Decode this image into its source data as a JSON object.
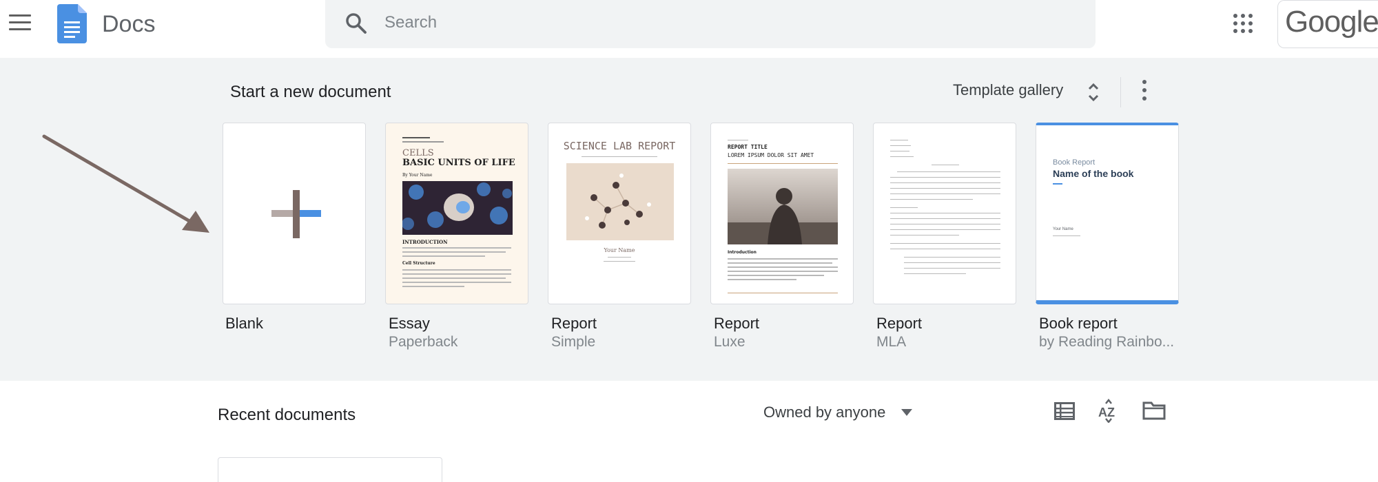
{
  "header": {
    "app_name": "Docs",
    "search_placeholder": "Search",
    "google_logo": "Google"
  },
  "template_section": {
    "title": "Start a new document",
    "gallery_label": "Template gallery",
    "templates": [
      {
        "label": "Blank",
        "sub": ""
      },
      {
        "label": "Essay",
        "sub": "Paperback"
      },
      {
        "label": "Report",
        "sub": "Simple"
      },
      {
        "label": "Report",
        "sub": "Luxe"
      },
      {
        "label": "Report",
        "sub": "MLA"
      },
      {
        "label": "Book report",
        "sub": "by Reading Rainbo..."
      }
    ]
  },
  "thumbnails": {
    "essay": {
      "title1": "CELLS",
      "title2": "BASIC UNITS OF LIFE",
      "byline": "By Your Name",
      "intro": "INTRODUCTION",
      "subhead": "Cell Structure"
    },
    "simple": {
      "title": "SCIENCE LAB REPORT",
      "name": "Your Name"
    },
    "luxe": {
      "title1": "REPORT TITLE",
      "title2": "LOREM IPSUM DOLOR SIT AMET",
      "intro": "Introduction"
    },
    "book": {
      "kicker": "Book Report",
      "title": "Name of the book",
      "name": "Your Name"
    }
  },
  "recent": {
    "title": "Recent documents",
    "owner_filter": "Owned by anyone"
  },
  "colors": {
    "accent_blue": "#4a90e2",
    "section_bg": "#f1f3f4",
    "arrow": "#7a6863"
  },
  "icons": [
    "hamburger-icon",
    "docs-logo-icon",
    "search-icon",
    "apps-grid-icon",
    "unfold-more-icon",
    "more-vert-icon",
    "caret-down-icon",
    "list-view-icon",
    "sort-az-icon",
    "folder-icon",
    "plus-icon"
  ]
}
